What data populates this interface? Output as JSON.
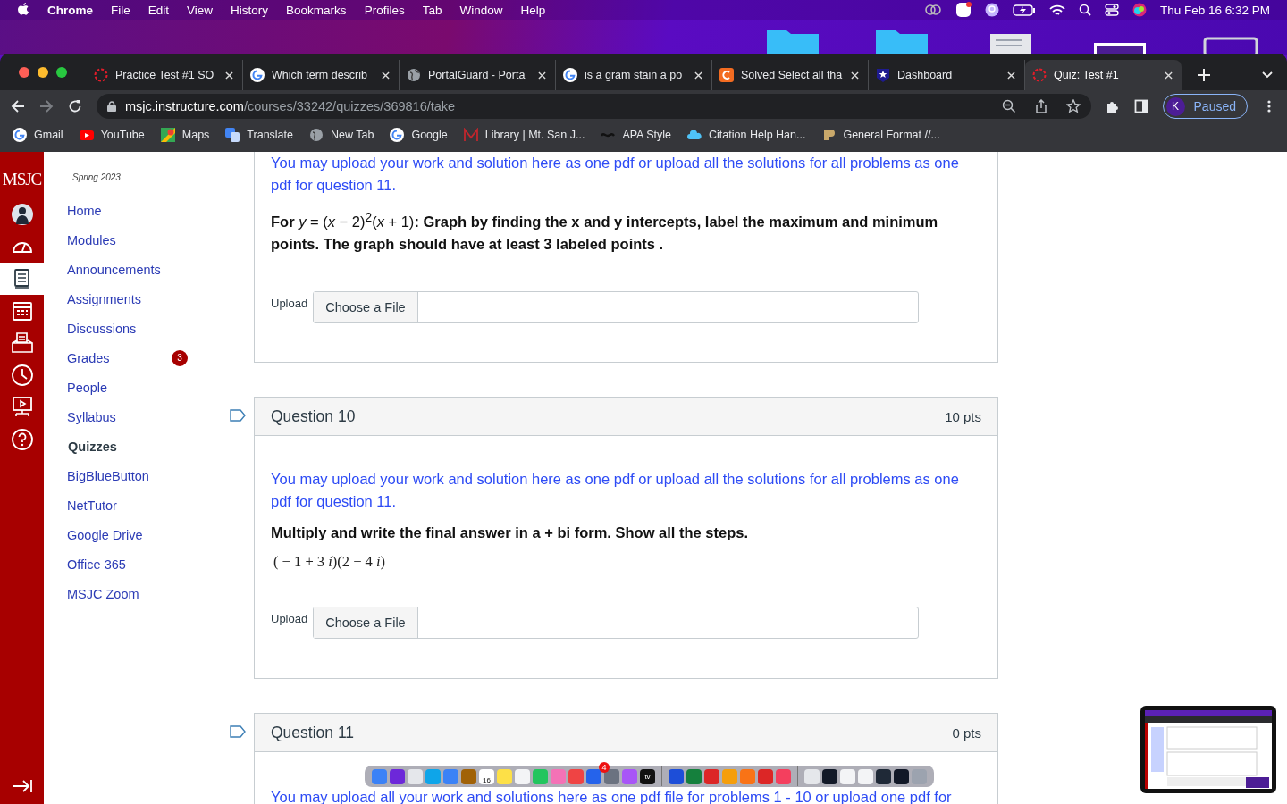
{
  "menu_bar": {
    "app": "Chrome",
    "menus": [
      "File",
      "Edit",
      "View",
      "History",
      "Bookmarks",
      "Profiles",
      "Tab",
      "Window",
      "Help"
    ],
    "clock": "Thu Feb 16  6:32 PM"
  },
  "browser": {
    "tabs": [
      {
        "title": "Practice Test #1 SO",
        "selected": false
      },
      {
        "title": "Which term describ",
        "selected": false
      },
      {
        "title": "PortalGuard - Porta",
        "selected": false
      },
      {
        "title": "is a gram stain a po",
        "selected": false
      },
      {
        "title": "Solved Select all tha",
        "selected": false
      },
      {
        "title": "Dashboard",
        "selected": false
      },
      {
        "title": "Quiz: Test #1",
        "selected": true
      }
    ],
    "url_host": "msjc.instructure.com",
    "url_path": "/courses/33242/quizzes/369816/take",
    "profile_initial": "K",
    "profile_status": "Paused",
    "bookmarks": [
      "Gmail",
      "YouTube",
      "Maps",
      "Translate",
      "New Tab",
      "Google",
      "Library | Mt. San J...",
      "APA Style",
      "Citation Help Han...",
      "General Format //..."
    ]
  },
  "canvas": {
    "logo": "MSJC",
    "global_nav": [
      {
        "selected": false
      },
      {
        "selected": false
      },
      {
        "selected": true
      },
      {
        "selected": false
      },
      {
        "selected": false
      },
      {
        "selected": false
      },
      {
        "selected": false
      },
      {
        "selected": false
      }
    ],
    "term": "Spring 2023",
    "course_nav": [
      {
        "label": "Home",
        "selected": false
      },
      {
        "label": "Modules",
        "selected": false
      },
      {
        "label": "Announcements",
        "selected": false
      },
      {
        "label": "Assignments",
        "selected": false
      },
      {
        "label": "Discussions",
        "selected": false
      },
      {
        "label": "Grades",
        "selected": false,
        "badge": "3"
      },
      {
        "label": "People",
        "selected": false
      },
      {
        "label": "Syllabus",
        "selected": false
      },
      {
        "label": "Quizzes",
        "selected": true
      },
      {
        "label": "BigBlueButton",
        "selected": false
      },
      {
        "label": "NetTutor",
        "selected": false
      },
      {
        "label": "Google Drive",
        "selected": false
      },
      {
        "label": "Office 365",
        "selected": false
      },
      {
        "label": "MSJC Zoom",
        "selected": false
      }
    ]
  },
  "quiz": {
    "partial_question": {
      "note": "You may upload your work and solution here as one pdf or upload all the solutions for all problems as one pdf for question 11.",
      "body": "**For** *y* = (*x* − 2)$^{2}$(*x* + 1)**:  Graph by finding the x and y intercepts, label the maximum and minimum points.  The graph should have at least 3 labeled points .**",
      "upload_label": "Upload",
      "upload_button": "Choose a File"
    },
    "questions": [
      {
        "title": "Question 10",
        "points": "10 pts",
        "note": "You may upload your work and solution here as one pdf or upload all the solutions for all problems as one pdf for question 11.",
        "body": "Multiply and write the final answer in a + bi form.  Show all the steps.",
        "expression": "( − 1 + 3 *i*)(2 − 4 *i*)",
        "upload_label": "Upload",
        "upload_button": "Choose a File"
      },
      {
        "title": "Question 11",
        "points": "0 pts",
        "note": "You may upload all your work and solutions here as one pdf file for problems 1 - 10 or upload one pdf for"
      }
    ]
  },
  "dock": {
    "calendar_day": "16",
    "badge": "4",
    "tv_label": "tv"
  }
}
